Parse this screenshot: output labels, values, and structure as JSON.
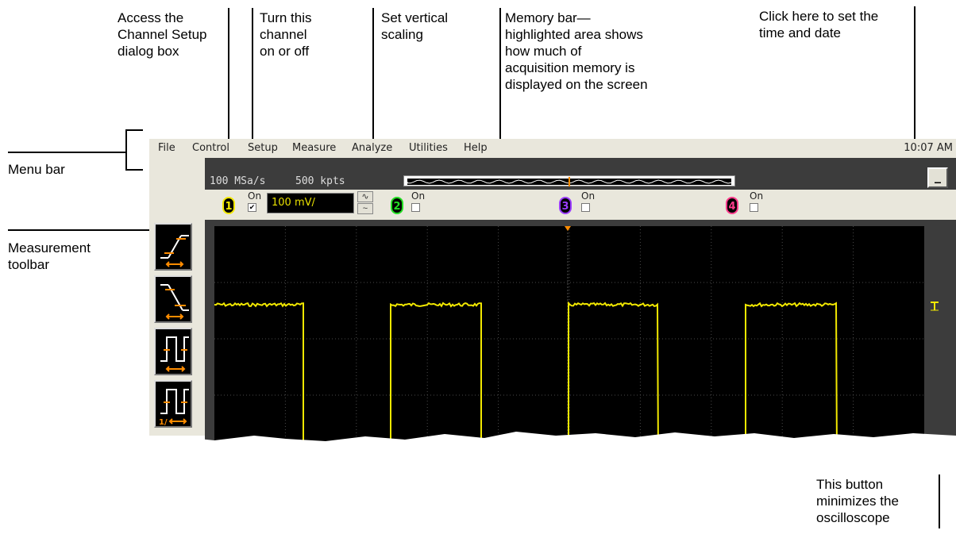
{
  "callouts": {
    "channel_setup": "Access the\nChannel Setup\ndialog box",
    "channel_toggle": "Turn this\nchannel\non or off",
    "vertical_scaling": "Set vertical\nscaling",
    "memory_bar": "Memory bar—\nhighlighted area shows\nhow much of\nacquisition memory is\ndisplayed on the screen",
    "time_date": "Click here to set the\ntime and date",
    "menu_bar": "Menu bar",
    "measurement_toolbar": "Measurement\ntoolbar",
    "minimize": "This button\nminimizes the\noscilloscope"
  },
  "menu": {
    "items": [
      "File",
      "Control",
      "Setup",
      "Measure",
      "Analyze",
      "Utilities",
      "Help"
    ],
    "clock": "10:07 AM"
  },
  "acquisition": {
    "sample_rate": "100 MSa/s",
    "memory_depth": "500 kpts"
  },
  "minimize_label": "_",
  "channels": [
    {
      "number": "1",
      "on_label": "On",
      "checked": true,
      "color": "#f2e800"
    },
    {
      "number": "2",
      "on_label": "On",
      "checked": false,
      "color": "#22dd22"
    },
    {
      "number": "3",
      "on_label": "On",
      "checked": false,
      "color": "#9b3dff"
    },
    {
      "number": "4",
      "on_label": "On",
      "checked": false,
      "color": "#ff3b8c"
    }
  ],
  "vertical_scale": "100 mV/",
  "toolbar": {
    "tools": [
      {
        "icon": "rise-time-icon"
      },
      {
        "icon": "fall-time-icon"
      },
      {
        "icon": "period-icon"
      },
      {
        "icon": "frequency-icon",
        "label": "1/"
      }
    ]
  },
  "colors": {
    "trace": "#f2e800",
    "accent": "#ff8c00",
    "screen": "#000000",
    "grid": "#4a4a4a"
  }
}
